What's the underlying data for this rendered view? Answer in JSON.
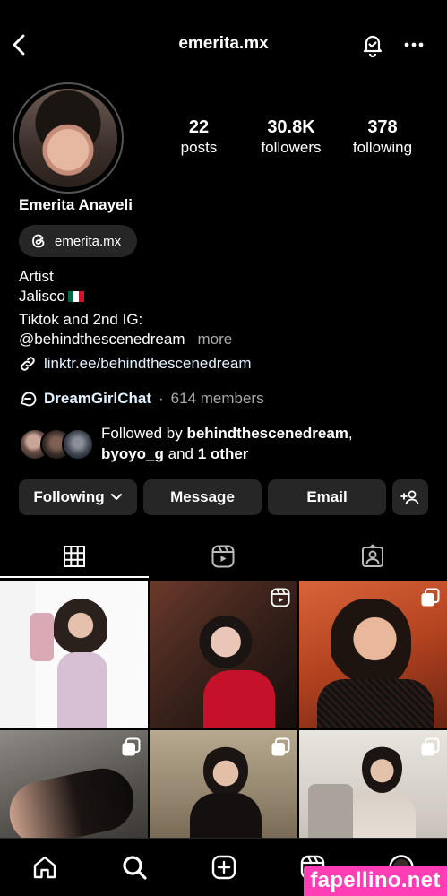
{
  "header": {
    "username": "emerita.mx"
  },
  "profile": {
    "display_name": "Emerita Anayeli",
    "threads_handle": "emerita.mx",
    "stats": [
      {
        "value": "22",
        "label": "posts"
      },
      {
        "value": "30.8K",
        "label": "followers"
      },
      {
        "value": "378",
        "label": "following"
      }
    ],
    "bio": {
      "line1": "Artist",
      "line2": "Jalisco",
      "line3": "Tiktok and 2nd IG:",
      "line4": "@behindthescenedream",
      "more": "more"
    },
    "link": "linktr.ee/behindthescenedream",
    "channel": {
      "name": "DreamGirlChat",
      "separator": "·",
      "members": "614 members"
    },
    "followed_by": {
      "prefix": "Followed by",
      "user1": "behindthescenedream",
      "comma": ",",
      "user2": "byoyo_g",
      "and": "and",
      "others": "1 other"
    }
  },
  "actions": {
    "following": "Following",
    "message": "Message",
    "email": "Email"
  },
  "colors": {
    "background": "#000000",
    "button_bg": "#262626",
    "link": "#e0f1ff",
    "muted": "#a8a8a8",
    "watermark": "#ff3db4"
  },
  "watermark": "fapellino.net"
}
